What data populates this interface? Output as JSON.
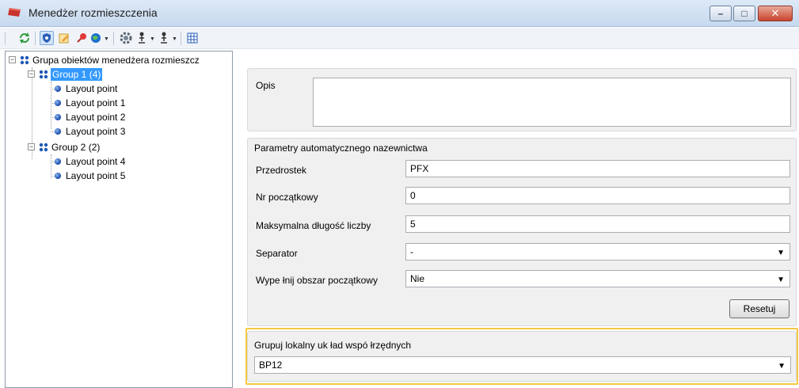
{
  "window": {
    "title": "Menedżer rozmieszczenia",
    "controls": {
      "minimize": "–",
      "maximize": "□",
      "close": "✕"
    }
  },
  "toolbar": {
    "buttons": [
      "refresh-icon",
      "shield-icon",
      "edit-icon",
      "pin-icon",
      "globe-dropdown-icon",
      "gear-icon",
      "person-dropdown-icon",
      "person-alt-dropdown-icon",
      "grid-icon"
    ]
  },
  "tree": {
    "root": {
      "label": "Grupa obiektów menedżera rozmieszcz",
      "expander": "−"
    },
    "groups": [
      {
        "label": "Group 1 (4)",
        "selected": true,
        "expander": "−",
        "items": [
          "Layout point",
          "Layout point 1",
          "Layout point  2",
          "Layout point 3"
        ]
      },
      {
        "label": "Group 2 (2)",
        "selected": false,
        "expander": "−",
        "items": [
          "Layout point 4",
          "Layout point 5"
        ]
      }
    ]
  },
  "description": {
    "label": "Opis",
    "value": ""
  },
  "naming": {
    "title": "Parametry automatycznego nazewnictwa",
    "prefix": {
      "label": "Przedrostek",
      "value": "PFX"
    },
    "start_no": {
      "label": "Nr początkowy",
      "value": "0"
    },
    "max_length": {
      "label": "Maksymalna długość liczby",
      "value": "5"
    },
    "separator": {
      "label": "Separator",
      "value": "-"
    },
    "fill_start": {
      "label": "Wype łnij obszar początkowy",
      "value": "Nie"
    },
    "reset_label": "Resetuj"
  },
  "coords": {
    "title": "Grupuj lokalny uk ład wspó łrzędnych",
    "value": "BP12"
  },
  "colors": {
    "selection": "#3399ff",
    "highlight": "#f5c842",
    "panel": "#f0f0f0"
  }
}
